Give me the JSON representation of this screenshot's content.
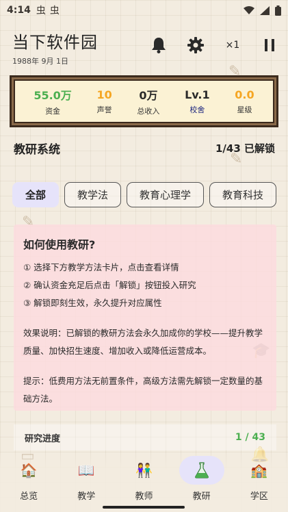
{
  "status_bar": {
    "time": "4:14",
    "notif_icons": [
      "虫",
      "虫"
    ]
  },
  "header": {
    "title": "当下软件园",
    "date": "1988年 9月 1日",
    "speed": "×1"
  },
  "stats": [
    {
      "value": "55.0万",
      "label": "资金",
      "color": "#4caf50"
    },
    {
      "value": "10",
      "label": "声誉",
      "color": "#f5a623"
    },
    {
      "value": "0万",
      "label": "总收入",
      "color": "#222222"
    },
    {
      "value": "Lv.1",
      "label": "校舍",
      "color": "#222222",
      "label_color": "#1a237e"
    },
    {
      "value": "0.0",
      "label": "星级",
      "color": "#f5a623"
    }
  ],
  "section": {
    "title": "教研系统",
    "count": "1/43 已解锁"
  },
  "tabs": [
    "全部",
    "教学法",
    "教育心理学",
    "教育科技"
  ],
  "help": {
    "title": "如何使用教研?",
    "steps": [
      "① 选择下方教学方法卡片，点击查看详情",
      "② 确认资金充足后点击「解锁」按钮投入研究",
      "③ 解锁即刻生效，永久提升对应属性"
    ],
    "effect": "效果说明：已解锁的教研方法会永久加成你的学校——提升教学质量、加快招生速度、增加收入或降低运营成本。",
    "tip": "提示：低费用方法无前置条件，高级方法需先解锁一定数量的基础方法。"
  },
  "progress": {
    "label": "研究进度",
    "value": "1 / 43"
  },
  "nav": [
    {
      "label": "总览",
      "icon": "school-house-icon",
      "glyph": "🏠"
    },
    {
      "label": "教学",
      "icon": "book-icon",
      "glyph": "📖"
    },
    {
      "label": "教师",
      "icon": "people-icon",
      "glyph": "👫"
    },
    {
      "label": "教研",
      "icon": "flask-icon",
      "glyph": "⚗"
    },
    {
      "label": "学区",
      "icon": "building-icon",
      "glyph": "🏫"
    }
  ],
  "colors": {
    "accent_green": "#4caf50",
    "accent_orange": "#f5a623",
    "active_pill": "#e6e3fa",
    "card_pink": "#fddade"
  }
}
